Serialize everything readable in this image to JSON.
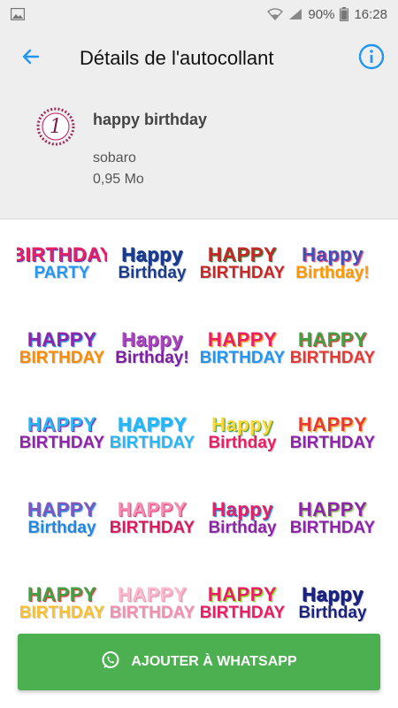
{
  "status_bar": {
    "battery": "90%",
    "time": "16:28"
  },
  "app_bar": {
    "title": "Détails de l'autocollant",
    "back_icon": "arrow-left-icon",
    "info_icon": "info-icon"
  },
  "pack": {
    "tray_number": "1",
    "name": "happy birthday",
    "publisher": "sobaro",
    "size": "0,95 Mo"
  },
  "stickers": [
    {
      "l1": "BIRTHDAY",
      "l2": "PARTY",
      "colors": [
        "#e91e63",
        "#673ab7",
        "#2196f3"
      ]
    },
    {
      "l1": "Happy",
      "l2": "Birthday",
      "colors": [
        "#1a3c8f",
        "#1a3c8f",
        "#1a3c8f"
      ]
    },
    {
      "l1": "HAPPY",
      "l2": "BIRTHDAY",
      "colors": [
        "#c62828",
        "#2e7d32",
        "#c62828"
      ]
    },
    {
      "l1": "Happy",
      "l2": "Birthday!",
      "colors": [
        "#3f51b5",
        "#ec407a",
        "#ff9800"
      ]
    },
    {
      "l1": "HAPPY",
      "l2": "BIRTHDAY",
      "colors": [
        "#8e24aa",
        "#1e88e5",
        "#fb8c00"
      ]
    },
    {
      "l1": "Happy",
      "l2": "Birthday!",
      "colors": [
        "#ab47bc",
        "#7b1fa2",
        "#7b1fa2"
      ]
    },
    {
      "l1": "HAPPY",
      "l2": "BIRTHDAY",
      "colors": [
        "#e91e63",
        "#ff9800",
        "#2196f3"
      ]
    },
    {
      "l1": "HAPPY",
      "l2": "BIRTHDAY",
      "colors": [
        "#43a047",
        "#e53935",
        "#e53935"
      ]
    },
    {
      "l1": "HAPPY",
      "l2": "BIRTHDAY",
      "colors": [
        "#29b6f6",
        "#8e24aa",
        "#8e24aa"
      ]
    },
    {
      "l1": "HAPPY",
      "l2": "BIRTHDAY",
      "colors": [
        "#29b6f6",
        "#29b6f6",
        "#29b6f6"
      ]
    },
    {
      "l1": "Happy",
      "l2": "Birthday",
      "colors": [
        "#fdd835",
        "#43a047",
        "#e91e63"
      ]
    },
    {
      "l1": "HAPPY",
      "l2": "BIRTHDAY",
      "colors": [
        "#e53935",
        "#fbc02d",
        "#8e24aa"
      ]
    },
    {
      "l1": "HAPPY",
      "l2": "Birthday",
      "colors": [
        "#7e57c2",
        "#1e88e5",
        "#1e88e5"
      ]
    },
    {
      "l1": "HAPPY",
      "l2": "BIRTHDAY",
      "colors": [
        "#f48fb1",
        "#ec407a",
        "#d81b60"
      ]
    },
    {
      "l1": "Happy",
      "l2": "Birthday",
      "colors": [
        "#e91e63",
        "#1e88e5",
        "#8e24aa"
      ]
    },
    {
      "l1": "HAPPY",
      "l2": "BIRTHDAY",
      "colors": [
        "#8e24aa",
        "#8bc34a",
        "#8e24aa"
      ]
    },
    {
      "l1": "HAPPY",
      "l2": "BIRTHDAY",
      "colors": [
        "#43a047",
        "#e53935",
        "#fbc02d"
      ]
    },
    {
      "l1": "HAPPY",
      "l2": "BIRTHDAY",
      "colors": [
        "#f8bbd0",
        "#f48fb1",
        "#f48fb1"
      ]
    },
    {
      "l1": "HAPPY",
      "l2": "BIRTHDAY",
      "colors": [
        "#e91e63",
        "#76ff03",
        "#e91e63"
      ]
    },
    {
      "l1": "Happy",
      "l2": "Birthday",
      "colors": [
        "#1a237e",
        "#1a237e",
        "#1a237e"
      ]
    }
  ],
  "add_button": {
    "label": "AJOUTER À WHATSAPP",
    "icon": "whatsapp-icon"
  }
}
